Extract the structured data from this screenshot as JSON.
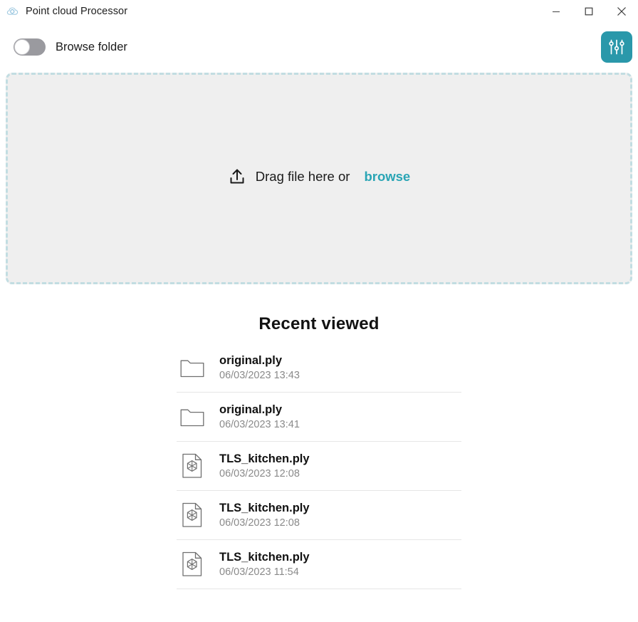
{
  "window": {
    "title": "Point cloud Processor",
    "app_icon": "cloud-icon",
    "controls": {
      "minimize": "minimize-icon",
      "maximize": "maximize-icon",
      "close": "close-icon"
    }
  },
  "toolbar": {
    "browse_folder_label": "Browse folder",
    "browse_folder_toggle_state": "off",
    "settings_icon": "sliders-icon",
    "accent_color": "#2a98aa"
  },
  "dropzone": {
    "icon": "upload-icon",
    "text": "Drag file here or",
    "browse_label": "browse",
    "browse_color": "#2aa5b5",
    "background_color": "#efefef",
    "border_color": "#c2dde2"
  },
  "recent": {
    "title": "Recent viewed",
    "items": [
      {
        "icon": "folder-icon",
        "name": "original.ply",
        "date": "06/03/2023 13:43"
      },
      {
        "icon": "folder-icon",
        "name": "original.ply",
        "date": "06/03/2023 13:41"
      },
      {
        "icon": "ply-file-icon",
        "name": "TLS_kitchen.ply",
        "date": "06/03/2023 12:08"
      },
      {
        "icon": "ply-file-icon",
        "name": "TLS_kitchen.ply",
        "date": "06/03/2023 12:08"
      },
      {
        "icon": "ply-file-icon",
        "name": "TLS_kitchen.ply",
        "date": "06/03/2023 11:54"
      }
    ]
  }
}
